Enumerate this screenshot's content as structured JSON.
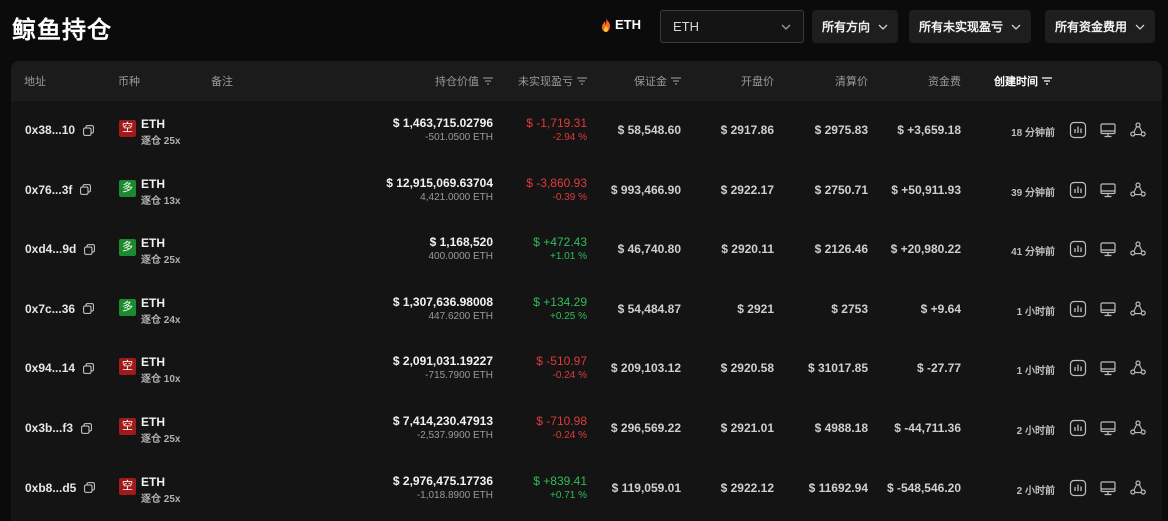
{
  "page": {
    "title": "鲸鱼持仓"
  },
  "filters": {
    "coin_tag": "ETH",
    "coin_select_value": "ETH",
    "direction": "所有方向",
    "unrealized_pnl": "所有未实现盈亏",
    "funding_fee": "所有资金费用"
  },
  "table": {
    "headers": {
      "address": "地址",
      "coin": "币种",
      "note": "备注",
      "position_value": "持仓价值",
      "unrealized_pnl": "未实现盈亏",
      "margin": "保证金",
      "entry_price": "开盘价",
      "liq_price": "清算价",
      "funding": "资金费",
      "created": "创建时间"
    },
    "rows": [
      {
        "address": "0x38...10",
        "side": "空",
        "side_type": "short",
        "symbol": "ETH",
        "leverage": "逐仓 25x",
        "value": "$ 1,463,715.02796",
        "size": "-501.0500 ETH",
        "pnl": "$ -1,719.31",
        "pnl_pct": "-2.94 %",
        "pnl_sign": "neg",
        "margin": "$ 58,548.60",
        "entry": "$ 2917.86",
        "liq": "$ 2975.83",
        "funding": "$ +3,659.18",
        "funding_sign": "pos",
        "created": "18 分钟前"
      },
      {
        "address": "0x76...3f",
        "side": "多",
        "side_type": "long",
        "symbol": "ETH",
        "leverage": "逐仓 13x",
        "value": "$ 12,915,069.63704",
        "size": "4,421.0000 ETH",
        "pnl": "$ -3,860.93",
        "pnl_pct": "-0.39 %",
        "pnl_sign": "neg",
        "margin": "$ 993,466.90",
        "entry": "$ 2922.17",
        "liq": "$ 2750.71",
        "funding": "$ +50,911.93",
        "funding_sign": "pos",
        "created": "39 分钟前"
      },
      {
        "address": "0xd4...9d",
        "side": "多",
        "side_type": "long",
        "symbol": "ETH",
        "leverage": "逐仓 25x",
        "value": "$ 1,168,520",
        "size": "400.0000 ETH",
        "pnl": "$ +472.43",
        "pnl_pct": "+1.01 %",
        "pnl_sign": "pos",
        "margin": "$ 46,740.80",
        "entry": "$ 2920.11",
        "liq": "$ 2126.46",
        "funding": "$ +20,980.22",
        "funding_sign": "pos",
        "created": "41 分钟前"
      },
      {
        "address": "0x7c...36",
        "side": "多",
        "side_type": "long",
        "symbol": "ETH",
        "leverage": "逐仓 24x",
        "value": "$ 1,307,636.98008",
        "size": "447.6200 ETH",
        "pnl": "$ +134.29",
        "pnl_pct": "+0.25 %",
        "pnl_sign": "pos",
        "margin": "$ 54,484.87",
        "entry": "$ 2921",
        "liq": "$ 2753",
        "funding": "$ +9.64",
        "funding_sign": "pos",
        "created": "1 小时前"
      },
      {
        "address": "0x94...14",
        "side": "空",
        "side_type": "short",
        "symbol": "ETH",
        "leverage": "逐仓 10x",
        "value": "$ 2,091,031.19227",
        "size": "-715.7900 ETH",
        "pnl": "$ -510.97",
        "pnl_pct": "-0.24 %",
        "pnl_sign": "neg",
        "margin": "$ 209,103.12",
        "entry": "$ 2920.58",
        "liq": "$ 31017.85",
        "funding": "$ -27.77",
        "funding_sign": "neg",
        "created": "1 小时前"
      },
      {
        "address": "0x3b...f3",
        "side": "空",
        "side_type": "short",
        "symbol": "ETH",
        "leverage": "逐仓 25x",
        "value": "$ 7,414,230.47913",
        "size": "-2,537.9900 ETH",
        "pnl": "$ -710.98",
        "pnl_pct": "-0.24 %",
        "pnl_sign": "neg",
        "margin": "$ 296,569.22",
        "entry": "$ 2921.01",
        "liq": "$ 4988.18",
        "funding": "$ -44,711.36",
        "funding_sign": "neg",
        "created": "2 小时前"
      },
      {
        "address": "0xb8...d5",
        "side": "空",
        "side_type": "short",
        "symbol": "ETH",
        "leverage": "逐仓 25x",
        "value": "$ 2,976,475.17736",
        "size": "-1,018.8900 ETH",
        "pnl": "$ +839.41",
        "pnl_pct": "+0.71 %",
        "pnl_sign": "pos",
        "margin": "$ 119,059.01",
        "entry": "$ 2922.12",
        "liq": "$ 11692.94",
        "funding": "$ -548,546.20",
        "funding_sign": "neg",
        "created": "2 小时前"
      }
    ]
  },
  "icons": {
    "coin_tag": "fire-icon",
    "dropdown": "chevron-down-icon",
    "sort": "sort-icon",
    "copy": "copy-icon",
    "actions": [
      "chart-icon",
      "monitor-icon",
      "share-icon"
    ]
  },
  "colors": {
    "positive": "#2fbd58",
    "negative": "#e03a3a",
    "short_badge": "#a11a1a",
    "long_badge": "#1b8a2e"
  }
}
